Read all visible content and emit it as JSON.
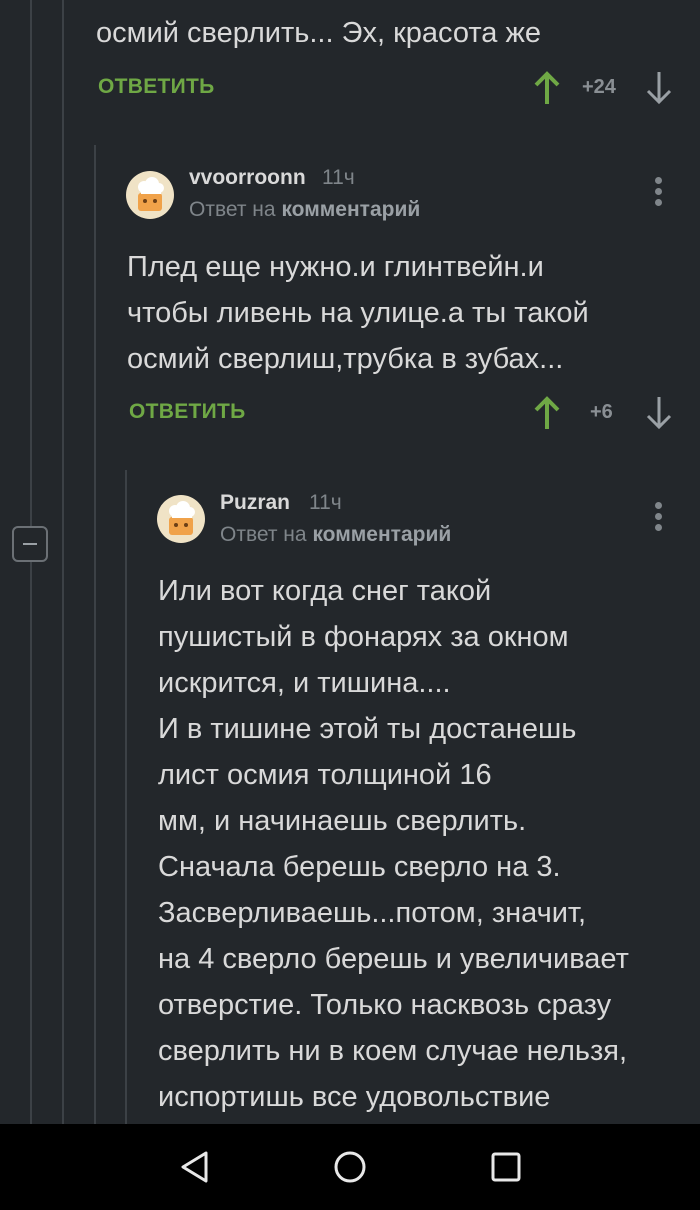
{
  "comments": [
    {
      "text_lines": [
        "осмий сверлить... Эх, красота же"
      ],
      "reply_label": "ОТВЕТИТЬ",
      "rating": "+24"
    },
    {
      "username": "vvoorroonn",
      "time": "11ч",
      "reply_prefix": "Ответ на",
      "reply_target": "комментарий",
      "text_lines": [
        "Плед еще нужно.и глинтвейн.и",
        "чтобы ливень на улице.а ты такой",
        "осмий сверлиш,трубка в зубах..."
      ],
      "reply_label": "ОТВЕТИТЬ",
      "rating": "+6"
    },
    {
      "username": "Puzran",
      "time": "11ч",
      "reply_prefix": "Ответ на",
      "reply_target": "комментарий",
      "text_lines": [
        "Или вот когда снег такой",
        "пушистый в фонарях за окном",
        "искрится, и тишина....",
        "И в тишине этой ты достанешь",
        "лист осмия толщиной 16",
        "мм, и начинаешь сверлить.",
        "Сначала берешь сверло на 3.",
        "Засверливаешь...потом, значит,",
        "на 4 сверло берешь и увеличивает",
        "отверстие. Только насквозь сразу",
        "сверлить ни в коем случае нельзя,",
        "испортишь все удовольствие"
      ]
    }
  ],
  "icons": {
    "upvote": "arrow-up-icon",
    "downvote": "arrow-down-icon",
    "more": "more-vertical-icon",
    "collapse": "minus-icon",
    "nav_back": "triangle-back-icon",
    "nav_home": "circle-home-icon",
    "nav_recents": "square-recents-icon"
  },
  "colors": {
    "background": "#23272b",
    "accent_green": "#6fa845",
    "muted": "#7f858a",
    "text": "#d9d9d9"
  }
}
